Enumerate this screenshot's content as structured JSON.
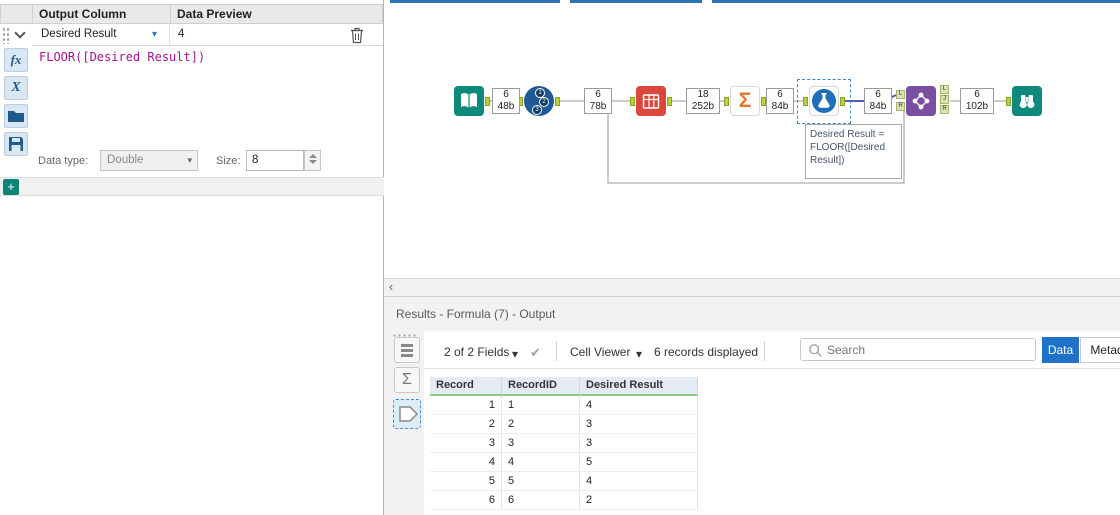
{
  "icons": {
    "caret_down": "▾",
    "check": "✔",
    "sigma": "Σ",
    "left_arrow": "‹"
  },
  "formula_panel": {
    "col_output": "Output Column",
    "col_preview": "Data Preview",
    "field_name": "Desired Result",
    "preview_value": "4",
    "expression": "FLOOR([Desired Result])",
    "fx_icon": "fx",
    "x_icon": "X",
    "data_type_label": "Data type:",
    "data_type_value": "Double",
    "size_label": "Size:",
    "size_value": "8",
    "add_label": "+"
  },
  "canvas": {
    "record_id_numbers": [
      "1",
      "2",
      "3"
    ],
    "connections": [
      {
        "records": "6",
        "size": "48b"
      },
      {
        "records": "6",
        "size": "78b"
      },
      {
        "records": "18",
        "size": "252b"
      },
      {
        "records": "6",
        "size": "84b"
      },
      {
        "records": "6",
        "size": "84b"
      },
      {
        "records": "6",
        "size": "102b"
      }
    ],
    "annotation": "Desired Result =\nFLOOR([Desired\nResult])",
    "join_inputs": [
      "L",
      "R"
    ],
    "join_outputs": [
      "L",
      "J",
      "R"
    ]
  },
  "results": {
    "title": "Results - Formula (7) - Output",
    "fields_summary": "2 of 2 Fields",
    "cell_viewer": "Cell Viewer",
    "records_displayed": "6 records displayed",
    "search_placeholder": "Search",
    "data_button": "Data",
    "metadata_button": "Metad",
    "table": {
      "headers": [
        "Record",
        "RecordID",
        "Desired Result"
      ],
      "rows": [
        [
          "1",
          "1",
          "4"
        ],
        [
          "2",
          "2",
          "3"
        ],
        [
          "3",
          "3",
          "3"
        ],
        [
          "4",
          "4",
          "5"
        ],
        [
          "5",
          "5",
          "4"
        ],
        [
          "6",
          "6",
          "2"
        ]
      ]
    }
  }
}
